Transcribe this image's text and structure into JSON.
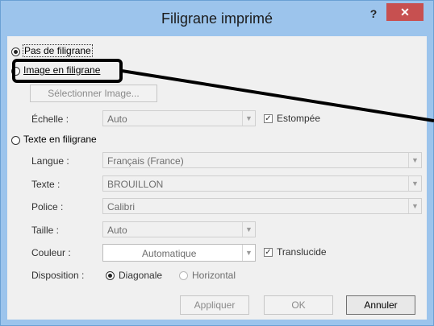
{
  "window": {
    "title": "Filigrane imprimé",
    "help_label": "?",
    "close_label": "✕"
  },
  "options": {
    "no_watermark": "Pas de filigrane",
    "picture_watermark": "Image en filigrane",
    "text_watermark": "Texte en filigrane"
  },
  "picture": {
    "select_button": "Sélectionner Image...",
    "scale_label": "Échelle :",
    "scale_value": "Auto",
    "washout_label": "Estompée"
  },
  "text": {
    "language_label": "Langue :",
    "language_value": "Français (France)",
    "text_label": "Texte :",
    "text_value": "BROUILLON",
    "font_label": "Police :",
    "font_value": "Calibri",
    "size_label": "Taille :",
    "size_value": "Auto",
    "color_label": "Couleur :",
    "color_value": "Automatique",
    "semitransparent_label": "Translucide",
    "layout_label": "Disposition :",
    "layout_diagonal": "Diagonale",
    "layout_horizontal": "Horizontal"
  },
  "buttons": {
    "apply": "Appliquer",
    "ok": "OK",
    "cancel": "Annuler"
  },
  "colors": {
    "titlebar": "#9cc4ec",
    "close": "#c75050",
    "callout": "#000000"
  }
}
